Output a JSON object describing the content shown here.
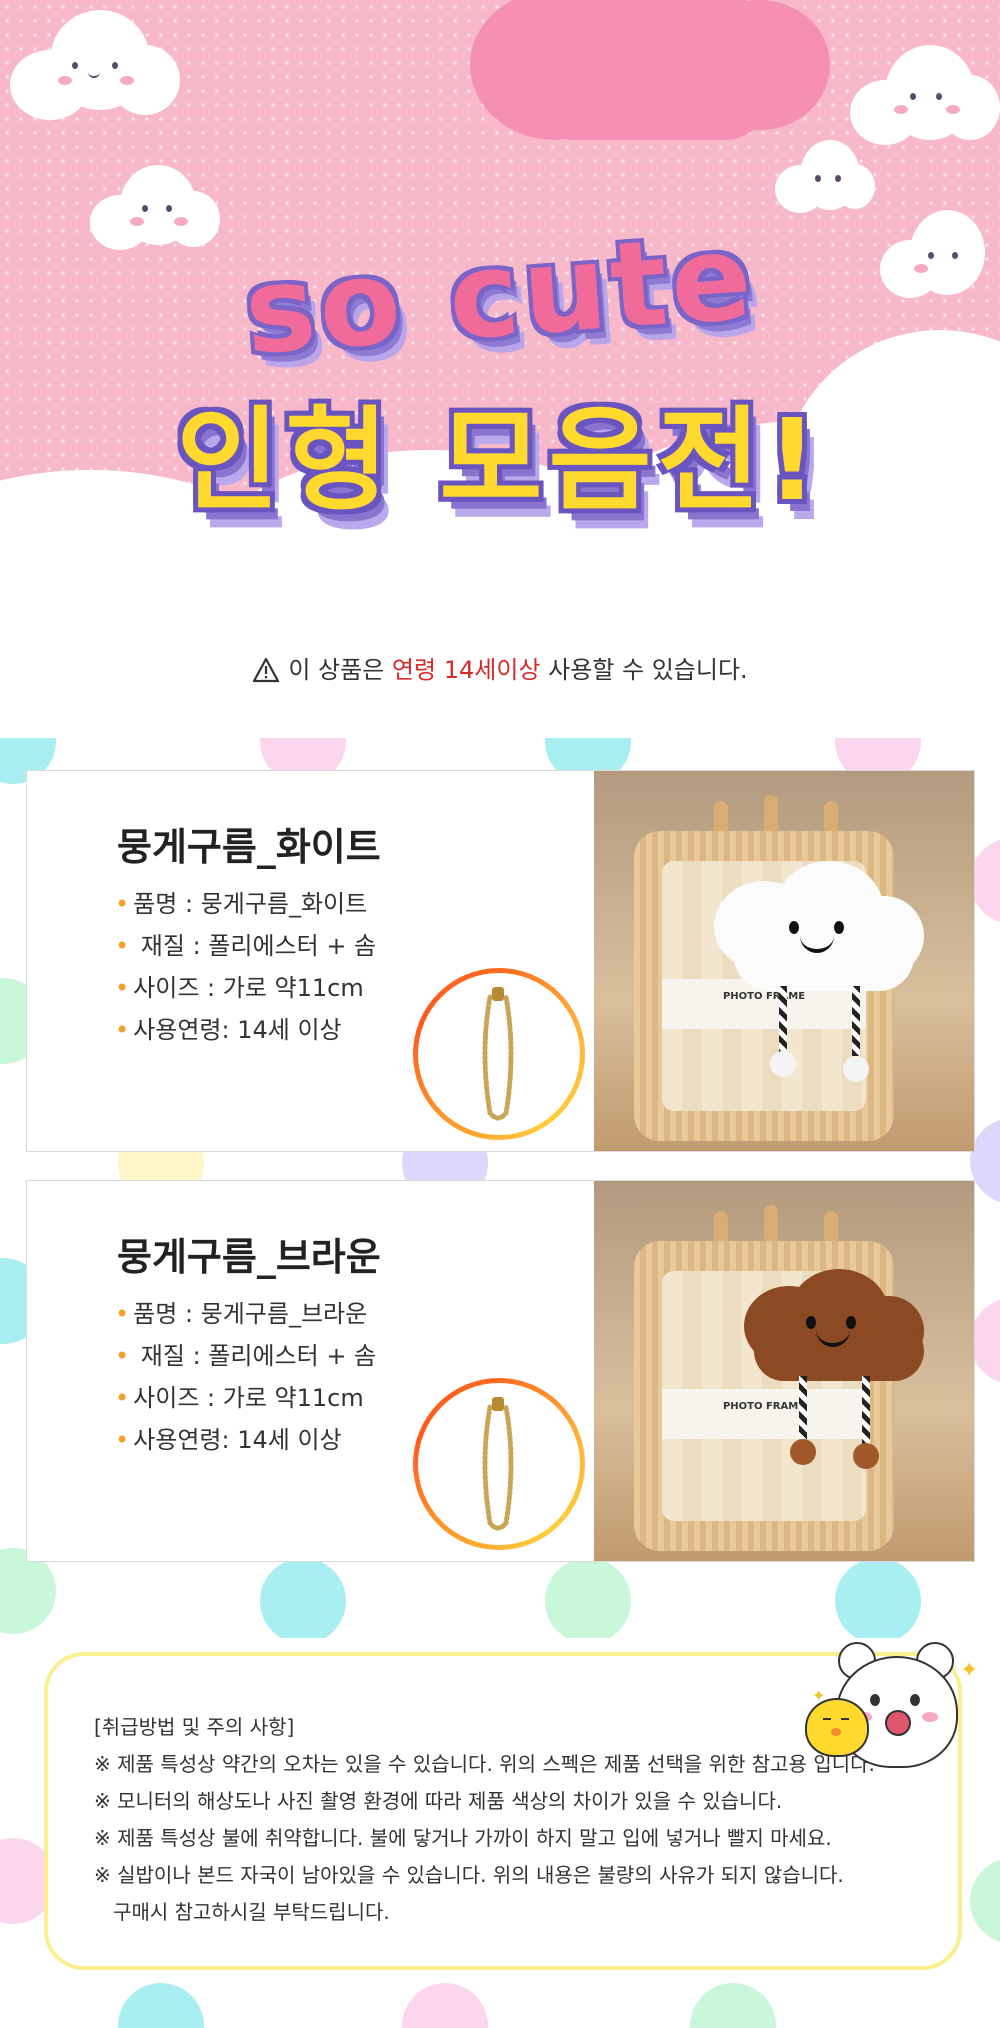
{
  "hero": {
    "title_line1": "so cute",
    "title_line2": "인형 모음전!"
  },
  "notice": {
    "prefix": "이 상품은 ",
    "highlight": "연령 14세이상",
    "suffix": " 사용할 수 있습니다."
  },
  "products": [
    {
      "name": "뭉게구름_화이트",
      "specs": [
        "품명 : 뭉게구름_화이트",
        " 재질 : 폴리에스터 + 솜",
        "사이즈 : 가로 약11cm",
        "사용연령: 14세 이상"
      ],
      "photo_label": "PHOTO FRAME",
      "plush_color": "#ffffff"
    },
    {
      "name": "뭉게구름_브라운",
      "specs": [
        "품명 : 뭉게구름_브라운",
        " 재질 : 폴리에스터 + 솜",
        "사이즈 : 가로 약11cm",
        "사용연령: 14세 이상"
      ],
      "photo_label": "PHOTO FRAME",
      "plush_color": "#8b4a22"
    }
  ],
  "caution": {
    "title": "[취급방법 및 주의 사항]",
    "lines": [
      "※ 제품 특성상 약간의 오차는 있을 수 있습니다. 위의 스펙은 제품 선택을 위한 참고용 입니다.",
      "※ 모니터의 해상도나 사진 촬영 환경에 따라 제품 색상의 차이가 있을 수 있습니다.",
      "※ 제품 특성상 불에 취약합니다. 불에 닿거나 가까이 하지 말고 입에 넣거나 빨지 마세요.",
      "※ 실밥이나 본드 자국이 남아있을 수 있습니다. 위의 내용은 불량의 사유가 되지 않습니다.",
      "   구매시 참고하시길 부탁드립니다."
    ]
  },
  "colors": {
    "hero_pink": "#f7b8c9",
    "title_pink": "#f06a9a",
    "title_yellow": "#ffd92e",
    "title_outline": "#6a55c0",
    "warning_red": "#d62b2b",
    "bullet_orange": "#f2a12a",
    "caution_border": "#fbef8f"
  },
  "icons": {
    "notice": "warning-triangle-icon"
  }
}
